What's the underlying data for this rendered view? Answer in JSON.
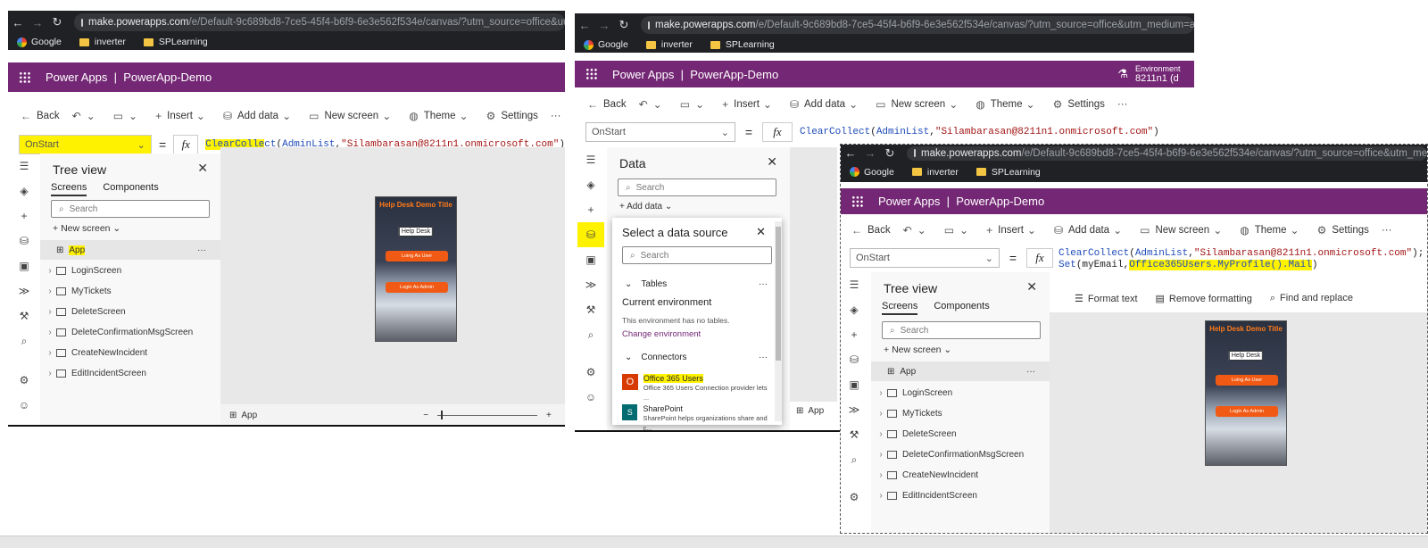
{
  "browser": {
    "url_host": "make.powerapps.com",
    "url_path_1": "/e/Default-9c689bd8-7ce5-45f4-b6f9-6e3e562f534e/canvas/?utm_source=office&utm_medium",
    "url_path_2": "/e/Default-9c689bd8-7ce5-45f4-b6f9-6e3e562f534e/canvas/?utm_source=office&utm_medium=app_launcher&",
    "url_path_3": "/e/Default-9c689bd8-7ce5-45f4-b6f9-6e3e562f534e/canvas/?utm_source=office&utm_medium=",
    "bookmarks": [
      "Google",
      "inverter",
      "SPLearning"
    ]
  },
  "app": {
    "product": "Power Apps",
    "separator": "|",
    "name": "PowerApp-Demo",
    "environment_label": "Environment",
    "environment_value": "8211n1 (d"
  },
  "toolbar": {
    "back": "Back",
    "insert": "Insert",
    "add_data": "Add data",
    "new_screen": "New screen",
    "theme": "Theme",
    "settings": "Settings",
    "more": "···"
  },
  "formula_bar": {
    "property": "OnStart",
    "equals": "=",
    "fx": "fx",
    "fn_highlight": "ClearCollect",
    "fn_first": "ClearColle",
    "fn_rest": "ct",
    "open": "(",
    "arg": "AdminList",
    "comma": ",",
    "str": "\"Silambarasan@8211n1.onmicrosoft.com\"",
    "close": ")",
    "close_semi": ");",
    "line2_fn": "Set",
    "line2_args": "(myEmail,",
    "line2_hl": "Office365Users.MyProfile().Mail",
    "line2_close": ")"
  },
  "format_bar": {
    "format_text": "Format text",
    "remove_formatting": "Remove formatting",
    "find_replace": "Find and replace"
  },
  "tree_view": {
    "title": "Tree view",
    "tab_screens": "Screens",
    "tab_components": "Components",
    "search_placeholder": "Search",
    "new_screen": "New screen",
    "app": "App",
    "more": "···",
    "screens": [
      "LoginScreen",
      "MyTickets",
      "DeleteScreen",
      "DeleteConfirmationMsgScreen",
      "CreateNewIncident",
      "EditIncidentScreen"
    ]
  },
  "phone": {
    "title": "Help Desk Demo Title",
    "header": "Help Desk",
    "btn_user": "Loing As User",
    "btn_admin": "Login As Admin"
  },
  "bottom": {
    "app": "App",
    "minus": "−",
    "plus": "+"
  },
  "data_panel": {
    "title": "Data",
    "search": "Search",
    "add_data": "Add data"
  },
  "data_source": {
    "title": "Select a data source",
    "search": "Search",
    "tables": "Tables",
    "current_env": "Current environment",
    "no_tables": "This environment has no tables.",
    "change_env": "Change environment",
    "connectors": "Connectors",
    "more": "···",
    "items": [
      {
        "name": "Office 365 Users",
        "desc": "Office 365 Users Connection provider lets ..."
      },
      {
        "name": "SharePoint",
        "desc": "SharePoint helps organizations share and c..."
      }
    ]
  }
}
